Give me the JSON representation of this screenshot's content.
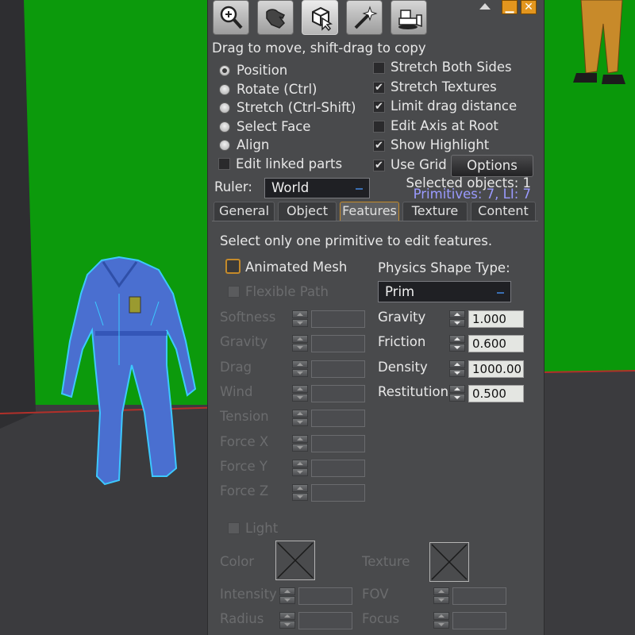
{
  "toolbar": {
    "tools": [
      "zoom-tool",
      "grab-tool",
      "build-tool",
      "create-tool",
      "land-tool"
    ]
  },
  "hint": "Drag to move, shift-drag to copy",
  "modes": [
    {
      "label": "Position",
      "selected": true
    },
    {
      "label": "Rotate (Ctrl)",
      "selected": false
    },
    {
      "label": "Stretch (Ctrl-Shift)",
      "selected": false
    },
    {
      "label": "Select Face",
      "selected": false
    },
    {
      "label": "Align",
      "selected": false
    }
  ],
  "edit_linked": {
    "label": "Edit linked parts",
    "checked": false
  },
  "options_checks": [
    {
      "label": "Stretch Both Sides",
      "checked": false
    },
    {
      "label": "Stretch Textures",
      "checked": true
    },
    {
      "label": "Limit drag distance",
      "checked": true
    },
    {
      "label": "Edit Axis at Root",
      "checked": false
    },
    {
      "label": "Show Highlight",
      "checked": true
    },
    {
      "label": "Use Grid",
      "checked": true
    }
  ],
  "options_button": "Options",
  "ruler": {
    "label": "Ruler:",
    "value": "World"
  },
  "selected_objects": "Selected objects: 1",
  "primitives": "Primitives: 7, LI: 7",
  "tabs": [
    {
      "label": "General",
      "active": false
    },
    {
      "label": "Object",
      "active": false
    },
    {
      "label": "Features",
      "active": true
    },
    {
      "label": "Texture",
      "active": false
    },
    {
      "label": "Content",
      "active": false
    }
  ],
  "features": {
    "notice": "Select only one primitive to edit features.",
    "animated_mesh": "Animated Mesh",
    "flexible_path": "Flexible Path",
    "flex_params": [
      "Softness",
      "Gravity",
      "Drag",
      "Wind",
      "Tension",
      "Force X",
      "Force Y",
      "Force Z"
    ],
    "physics_shape_label": "Physics Shape Type:",
    "physics_shape_value": "Prim",
    "physics_params": [
      {
        "label": "Gravity",
        "value": "1.000"
      },
      {
        "label": "Friction",
        "value": "0.600"
      },
      {
        "label": "Density",
        "value": "1000.00"
      },
      {
        "label": "Restitution",
        "value": "0.500"
      }
    ],
    "light": "Light",
    "color": "Color",
    "texture": "Texture",
    "intensity": "Intensity",
    "fov": "FOV",
    "radius": "Radius",
    "focus": "Focus"
  },
  "colors": {
    "panel_bg": "#494a4c",
    "scene_green": "#0c9a0c",
    "active_tab_border": "#c48a2a",
    "primitives_text": "#9a9aff",
    "mesh_blue": "#4a6fd0"
  }
}
